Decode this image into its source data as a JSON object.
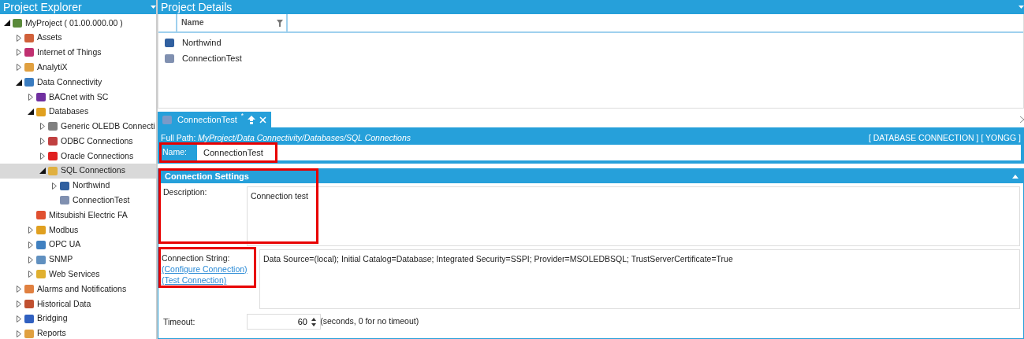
{
  "explorer": {
    "title": "Project Explorer",
    "tree": [
      {
        "label": "MyProject ( 01.00.000.00 )",
        "kind": "branch",
        "expanded": true,
        "selected": false,
        "color": "#5a8a3a",
        "children": [
          {
            "label": "Assets",
            "kind": "branch",
            "expanded": false,
            "selected": false,
            "color": "#d0603a"
          },
          {
            "label": "Internet of Things",
            "kind": "branch",
            "expanded": false,
            "selected": false,
            "color": "#c03070"
          },
          {
            "label": "AnalytiX",
            "kind": "branch",
            "expanded": false,
            "selected": false,
            "color": "#e0a040"
          },
          {
            "label": "Data Connectivity",
            "kind": "branch",
            "expanded": true,
            "selected": false,
            "color": "#3a7cc0",
            "children": [
              {
                "label": "BACnet with SC",
                "kind": "branch",
                "expanded": false,
                "selected": false,
                "color": "#7030a0"
              },
              {
                "label": "Databases",
                "kind": "branch",
                "expanded": true,
                "selected": false,
                "color": "#e0a020",
                "children": [
                  {
                    "label": "Generic OLEDB Connecti",
                    "kind": "branch",
                    "expanded": false,
                    "selected": false,
                    "color": "#808080"
                  },
                  {
                    "label": "ODBC Connections",
                    "kind": "branch",
                    "expanded": false,
                    "selected": false,
                    "color": "#c04040"
                  },
                  {
                    "label": "Oracle Connections",
                    "kind": "branch",
                    "expanded": false,
                    "selected": false,
                    "color": "#e02020"
                  },
                  {
                    "label": "SQL Connections",
                    "kind": "branch",
                    "expanded": true,
                    "selected": true,
                    "color": "#e0b040",
                    "children": [
                      {
                        "label": "Northwind",
                        "kind": "branch",
                        "expanded": false,
                        "selected": false,
                        "color": "#3060a0"
                      },
                      {
                        "label": "ConnectionTest",
                        "kind": "leaf",
                        "selected": false,
                        "color": "#8090b0"
                      }
                    ]
                  }
                ]
              },
              {
                "label": "Mitsubishi Electric FA",
                "kind": "leaf",
                "selected": false,
                "color": "#e05030"
              },
              {
                "label": "Modbus",
                "kind": "branch",
                "expanded": false,
                "selected": false,
                "color": "#e0a020"
              },
              {
                "label": "OPC UA",
                "kind": "branch",
                "expanded": false,
                "selected": false,
                "color": "#4080c0"
              },
              {
                "label": "SNMP",
                "kind": "branch",
                "expanded": false,
                "selected": false,
                "color": "#6090c0"
              },
              {
                "label": "Web Services",
                "kind": "branch",
                "expanded": false,
                "selected": false,
                "color": "#e0b030"
              }
            ]
          },
          {
            "label": "Alarms and Notifications",
            "kind": "branch",
            "expanded": false,
            "selected": false,
            "color": "#e08040"
          },
          {
            "label": "Historical Data",
            "kind": "branch",
            "expanded": false,
            "selected": false,
            "color": "#c05030"
          },
          {
            "label": "Bridging",
            "kind": "branch",
            "expanded": false,
            "selected": false,
            "color": "#3060c0"
          },
          {
            "label": "Reports",
            "kind": "branch",
            "expanded": false,
            "selected": false,
            "color": "#e0a040"
          }
        ]
      }
    ]
  },
  "details": {
    "title": "Project Details",
    "column": "Name",
    "rows": [
      {
        "name": "Northwind",
        "color": "#3060a0"
      },
      {
        "name": "ConnectionTest",
        "color": "#8090b0"
      }
    ]
  },
  "editor": {
    "tab": {
      "label": "ConnectionTest",
      "modified_mark": "*",
      "selected": true
    },
    "full_path_label": "Full Path:",
    "full_path": "MyProject/Data Connectivity/Databases/SQL Connections",
    "tags": "[ DATABASE CONNECTION ] [ YONGG ]",
    "name": {
      "label": "Name:",
      "value": "ConnectionTest",
      "highlighted": true
    },
    "section": {
      "title": "Connection Settings",
      "expanded": true
    },
    "description": {
      "label": "Description:",
      "value": "Connection test",
      "highlighted": true
    },
    "connection_string": {
      "label": "Connection String:",
      "links": [
        "(Configure Connection)",
        "(Test Connection)"
      ],
      "value": "Data Source=(local); Initial Catalog=Database; Integrated Security=SSPI; Provider=MSOLEDBSQL; TrustServerCertificate=True",
      "highlighted": true
    },
    "timeout": {
      "label": "Timeout:",
      "value": "60",
      "hint": "(seconds, 0 for no timeout)"
    }
  }
}
